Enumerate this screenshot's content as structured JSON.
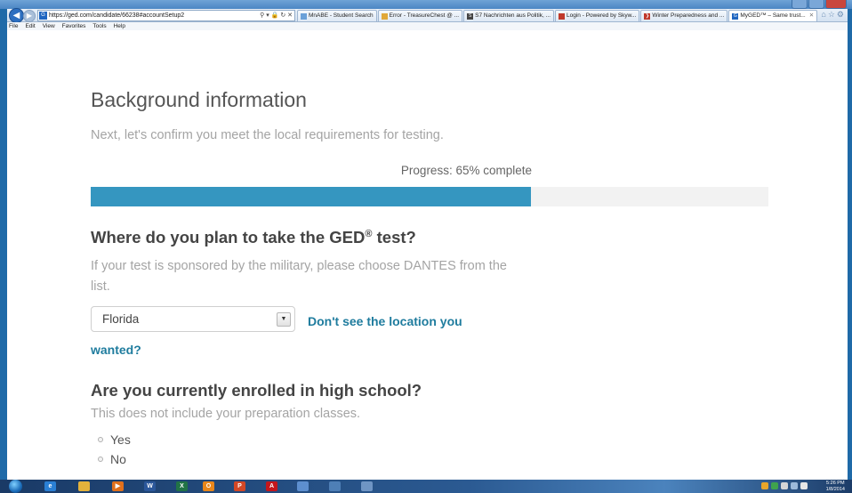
{
  "browser": {
    "url": "https://ged.com/candidate/66238#accountSetup2",
    "tabs": [
      {
        "label": "MnABE - Student Search",
        "icon": "abe-icon",
        "color": "#6aa0d8"
      },
      {
        "label": "Error - TreasureChest @ ...",
        "icon": "folder-icon",
        "color": "#e0a838"
      },
      {
        "label": "S7 Nachrichten aus Politik, ...",
        "icon": "s7-icon",
        "color": "#444444"
      },
      {
        "label": "Login - Powered by Skyw...",
        "icon": "bird-icon",
        "color": "#c0392b"
      },
      {
        "label": "Winter Preparedness and ...",
        "icon": "arrow-icon",
        "color": "#c0392b"
      },
      {
        "label": "MyGED™ – Same trust...",
        "icon": "ged-icon",
        "color": "#1f66c1",
        "active": true
      }
    ],
    "menu": [
      "File",
      "Edit",
      "View",
      "Favorites",
      "Tools",
      "Help"
    ]
  },
  "page": {
    "title": "Background information",
    "subtitle": "Next, let's confirm you meet the local requirements for testing.",
    "progress_text": "Progress: 65% complete",
    "progress_percent": 65,
    "q1": {
      "title": "Where do you plan to take the GED",
      "reg": "®",
      "title_end": " test?",
      "help": "If your test is sponsored by the military, please choose DANTES from the list.",
      "selected": "Florida",
      "link_part1": "Don't see the location you",
      "link_part2": "wanted?"
    },
    "q2": {
      "title": "Are you currently enrolled in high school?",
      "help": "This does not include your preparation classes.",
      "options": [
        "Yes",
        "No"
      ]
    }
  },
  "taskbar": {
    "time": "5:26 PM",
    "date": "1/8/2014"
  },
  "colors": {
    "accent": "#3596c0",
    "link": "#1f7c9e"
  }
}
